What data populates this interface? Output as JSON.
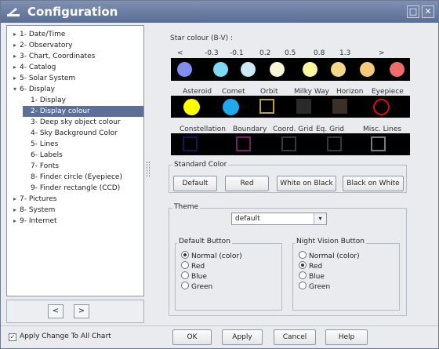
{
  "window": {
    "title": "Configuration",
    "minimize_label": "□",
    "close_label": "✕"
  },
  "tree": [
    {
      "label": "1- Date/Time",
      "expander": "▸"
    },
    {
      "label": "2- Observatory",
      "expander": "▸"
    },
    {
      "label": "3- Chart, Coordinates",
      "expander": "▸"
    },
    {
      "label": "4- Catalog",
      "expander": "▸"
    },
    {
      "label": "5- Solar System",
      "expander": "▸"
    },
    {
      "label": "6- Display",
      "expander": "▾"
    },
    {
      "label": "1- Display",
      "expander": ""
    },
    {
      "label": "2- Display colour",
      "expander": ""
    },
    {
      "label": "3- Deep sky object colour",
      "expander": ""
    },
    {
      "label": "4- Sky Background Color",
      "expander": ""
    },
    {
      "label": "5- Lines",
      "expander": ""
    },
    {
      "label": "6- Labels",
      "expander": ""
    },
    {
      "label": "7- Fonts",
      "expander": ""
    },
    {
      "label": "8- Finder circle (Eyepiece)",
      "expander": ""
    },
    {
      "label": "9- Finder rectangle (CCD)",
      "expander": ""
    },
    {
      "label": "7- Pictures",
      "expander": "▸"
    },
    {
      "label": "8- System",
      "expander": "▸"
    },
    {
      "label": "9- Internet",
      "expander": "▸"
    }
  ],
  "nav": {
    "prev": "<",
    "next": ">"
  },
  "star_colour": {
    "title": "Star colour (B-V) :",
    "ticks": [
      "<",
      "-0.3",
      "-0.1",
      "0.2",
      "0.5",
      "0.8",
      "1.3",
      ">"
    ],
    "colors": [
      "#7f8ff0",
      "#7fd9f2",
      "#cde9f7",
      "#f8f4d8",
      "#fbf6a0",
      "#f3d987",
      "#f6c87d",
      "#f26c6c"
    ]
  },
  "objects": {
    "labels": [
      "Asteroid",
      "Comet",
      "Orbit",
      "Milky Way",
      "Horizon",
      "Eyepiece"
    ],
    "colors": [
      "#ffff00",
      "#21a9ee",
      "#b8a24a",
      "#2a2a2a",
      "#3a3028",
      "#d81010"
    ]
  },
  "lines": {
    "labels": [
      "Constellation",
      "Boundary",
      "Coord. Grid",
      "Eq. Grid",
      "Misc. Lines"
    ],
    "colors": [
      "#14145a",
      "#7a1b6b",
      "#3a3a3a",
      "#3a3a3a",
      "#7a7a7a"
    ]
  },
  "standard_color": {
    "title": "Standard Color",
    "buttons": [
      "Default",
      "Red",
      "White on Black",
      "Black on White"
    ]
  },
  "theme": {
    "title": "Theme",
    "value": "default",
    "arrow": "▾"
  },
  "default_button": {
    "title": "Default Button",
    "options": [
      "Normal (color)",
      "Red",
      "Blue",
      "Green"
    ],
    "selected": 0
  },
  "night_vision": {
    "title": "Night Vision Button",
    "options": [
      "Normal (color)",
      "Red",
      "Blue",
      "Green"
    ],
    "selected": 1
  },
  "footer": {
    "apply_all_label": "Apply Change To All Chart",
    "apply_all_checked": true,
    "check_mark": "✓",
    "ok": "OK",
    "apply": "Apply",
    "cancel": "Cancel",
    "help": "Help"
  }
}
